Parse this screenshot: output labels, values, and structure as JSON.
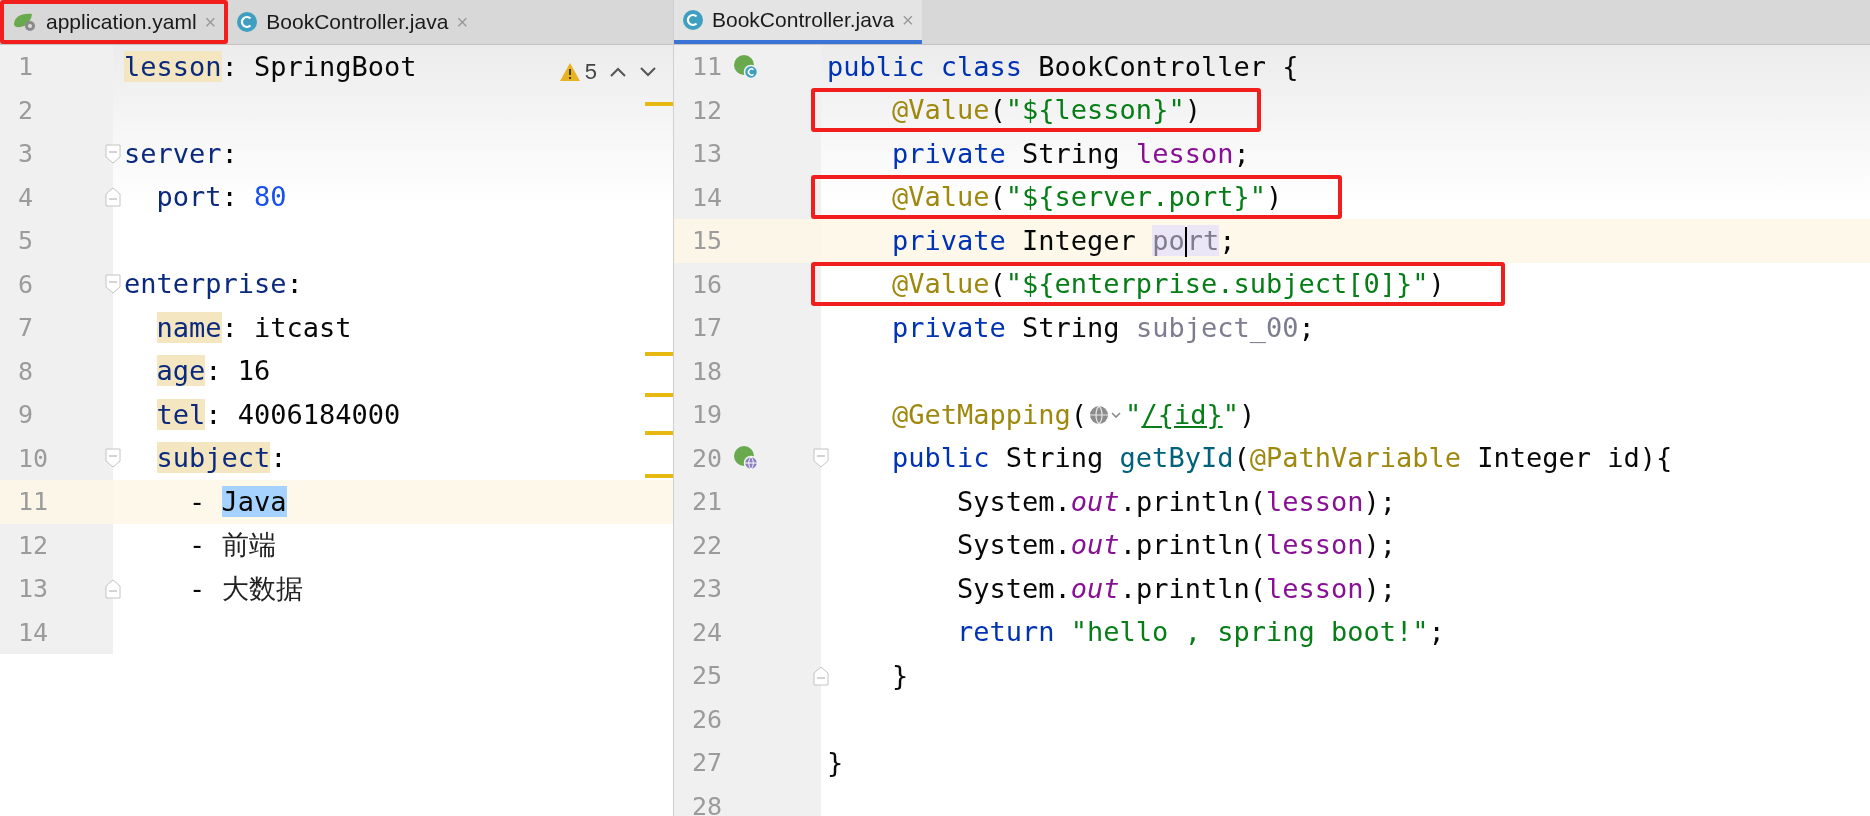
{
  "panes": [
    {
      "tabs": [
        {
          "label": "application.yaml",
          "kind": "yaml",
          "close": "×",
          "selected": false,
          "boxed": true
        },
        {
          "label": "BookController.java",
          "kind": "java",
          "close": "×",
          "selected": false,
          "boxed": false
        }
      ],
      "inspections": {
        "count": "5"
      },
      "lines": [
        {
          "n": "1",
          "current": false,
          "tokens": [
            {
              "t": "lesson",
              "kind": "usedkey"
            },
            {
              "t": ": SpringBoot",
              "kind": "plain"
            }
          ]
        },
        {
          "n": "2",
          "current": false
        },
        {
          "n": "3",
          "current": false,
          "fold": {
            "kind": "start"
          },
          "tokens": [
            {
              "t": "server",
              "kind": "key"
            },
            {
              "t": ":",
              "kind": "plain"
            }
          ]
        },
        {
          "n": "4",
          "current": false,
          "fold": {
            "kind": "end"
          },
          "tokens": [
            {
              "t": "  port",
              "kind": "key"
            },
            {
              "t": ": ",
              "kind": "plain"
            },
            {
              "t": "80",
              "kind": "number"
            }
          ]
        },
        {
          "n": "5",
          "current": false
        },
        {
          "n": "6",
          "current": false,
          "fold": {
            "kind": "start"
          },
          "tokens": [
            {
              "t": "enterprise",
              "kind": "key"
            },
            {
              "t": ":",
              "kind": "plain"
            }
          ]
        },
        {
          "n": "7",
          "current": false,
          "tokens": [
            {
              "t": "  name",
              "kind": "usedkey"
            },
            {
              "t": ": itcast",
              "kind": "plain"
            }
          ]
        },
        {
          "n": "8",
          "current": false,
          "tokens": [
            {
              "t": "  age",
              "kind": "usedkey"
            },
            {
              "t": ": 16",
              "kind": "plain"
            }
          ]
        },
        {
          "n": "9",
          "current": false,
          "tokens": [
            {
              "t": "  tel",
              "kind": "usedkey"
            },
            {
              "t": ": 4006184000",
              "kind": "plain"
            }
          ]
        },
        {
          "n": "10",
          "current": false,
          "fold": {
            "kind": "start"
          },
          "tokens": [
            {
              "t": "  subject",
              "kind": "usedkey"
            },
            {
              "t": ":",
              "kind": "plain"
            }
          ]
        },
        {
          "n": "11",
          "current": true,
          "tokens": [
            {
              "t": "    - ",
              "kind": "plain"
            },
            {
              "t": "Java",
              "kind": "selectedtext"
            }
          ]
        },
        {
          "n": "12",
          "current": false,
          "tokens": [
            {
              "t": "    - ",
              "kind": "plain"
            },
            {
              "t": "前端",
              "kind": "cjk"
            }
          ]
        },
        {
          "n": "13",
          "current": false,
          "fold": {
            "kind": "end"
          },
          "tokens": [
            {
              "t": "    - ",
              "kind": "plain"
            },
            {
              "t": "大数据",
              "kind": "cjk"
            }
          ]
        },
        {
          "n": "14",
          "current": false
        }
      ]
    },
    {
      "tabs": [
        {
          "label": "BookController.java",
          "kind": "java",
          "close": "×",
          "selected": true,
          "boxed": false
        }
      ],
      "lines": [
        {
          "n": "11",
          "current": false,
          "boxed": false,
          "marker": {
            "kind": "class"
          },
          "tokens": [
            {
              "t": "public class ",
              "kind": "keyword"
            },
            {
              "t": "BookController {",
              "kind": "plain"
            }
          ]
        },
        {
          "n": "12",
          "current": false,
          "boxed": true,
          "tokens": [
            {
              "t": "    @Value",
              "kind": "annotation"
            },
            {
              "t": "(",
              "kind": "plain"
            },
            {
              "t": "\"${lesson}\"",
              "kind": "string"
            },
            {
              "t": ")",
              "kind": "plain"
            }
          ]
        },
        {
          "n": "13",
          "current": false,
          "boxed": false,
          "tokens": [
            {
              "t": "    private ",
              "kind": "keyword"
            },
            {
              "t": "String ",
              "kind": "plain"
            },
            {
              "t": "lesson",
              "kind": "field"
            },
            {
              "t": ";",
              "kind": "plain"
            }
          ]
        },
        {
          "n": "14",
          "current": false,
          "boxed": true,
          "tokens": [
            {
              "t": "    @Value",
              "kind": "annotation"
            },
            {
              "t": "(",
              "kind": "plain"
            },
            {
              "t": "\"${server.port}\"",
              "kind": "string"
            },
            {
              "t": ")",
              "kind": "plain"
            }
          ]
        },
        {
          "n": "15",
          "current": true,
          "boxed": false,
          "tokens": [
            {
              "t": "    private ",
              "kind": "keyword"
            },
            {
              "t": "Integer ",
              "kind": "plain"
            },
            {
              "t": "po",
              "kind": "wordunused"
            },
            {
              "kind": "caret"
            },
            {
              "t": "rt",
              "kind": "wordunused"
            },
            {
              "t": ";",
              "kind": "plain"
            }
          ]
        },
        {
          "n": "16",
          "current": false,
          "boxed": true,
          "tokens": [
            {
              "t": "    @Value",
              "kind": "annotation"
            },
            {
              "t": "(",
              "kind": "plain"
            },
            {
              "t": "\"${enterprise.subject[0]}\"",
              "kind": "string"
            },
            {
              "t": ")",
              "kind": "plain"
            }
          ]
        },
        {
          "n": "17",
          "current": false,
          "boxed": false,
          "tokens": [
            {
              "t": "    private ",
              "kind": "keyword"
            },
            {
              "t": "String ",
              "kind": "plain"
            },
            {
              "t": "subject_00",
              "kind": "unused"
            },
            {
              "t": ";",
              "kind": "plain"
            }
          ]
        },
        {
          "n": "18",
          "current": false,
          "boxed": false
        },
        {
          "n": "19",
          "current": false,
          "boxed": false,
          "tokens": [
            {
              "t": "    @GetMapping",
              "kind": "annotation"
            },
            {
              "t": "(",
              "kind": "plain"
            },
            {
              "kind": "urlicon"
            },
            {
              "t": "\"",
              "kind": "string"
            },
            {
              "t": "/{id}",
              "kind": "url"
            },
            {
              "t": "\"",
              "kind": "string"
            },
            {
              "t": ")",
              "kind": "plain"
            }
          ]
        },
        {
          "n": "20",
          "current": false,
          "boxed": false,
          "marker": {
            "kind": "web"
          },
          "fold": {
            "kind": "start"
          },
          "tokens": [
            {
              "t": "    public ",
              "kind": "keyword"
            },
            {
              "t": "String ",
              "kind": "plain"
            },
            {
              "t": "getById",
              "kind": "method"
            },
            {
              "t": "(",
              "kind": "plain"
            },
            {
              "t": "@PathVariable",
              "kind": "annotation"
            },
            {
              "t": " Integer id){",
              "kind": "plain"
            }
          ]
        },
        {
          "n": "21",
          "current": false,
          "boxed": false,
          "tokens": [
            {
              "t": "        System.",
              "kind": "plain"
            },
            {
              "t": "out",
              "kind": "static"
            },
            {
              "t": ".println(",
              "kind": "plain"
            },
            {
              "t": "lesson",
              "kind": "field"
            },
            {
              "t": ");",
              "kind": "plain"
            }
          ]
        },
        {
          "n": "22",
          "current": false,
          "boxed": false,
          "tokens": [
            {
              "t": "        System.",
              "kind": "plain"
            },
            {
              "t": "out",
              "kind": "static"
            },
            {
              "t": ".println(",
              "kind": "plain"
            },
            {
              "t": "lesson",
              "kind": "field"
            },
            {
              "t": ");",
              "kind": "plain"
            }
          ]
        },
        {
          "n": "23",
          "current": false,
          "boxed": false,
          "tokens": [
            {
              "t": "        System.",
              "kind": "plain"
            },
            {
              "t": "out",
              "kind": "static"
            },
            {
              "t": ".println(",
              "kind": "plain"
            },
            {
              "t": "lesson",
              "kind": "field"
            },
            {
              "t": ");",
              "kind": "plain"
            }
          ]
        },
        {
          "n": "24",
          "current": false,
          "boxed": false,
          "tokens": [
            {
              "t": "        return ",
              "kind": "keyword"
            },
            {
              "t": "\"hello , spring boot!\"",
              "kind": "string"
            },
            {
              "t": ";",
              "kind": "plain"
            }
          ]
        },
        {
          "n": "25",
          "current": false,
          "boxed": false,
          "fold": {
            "kind": "end"
          },
          "tokens": [
            {
              "t": "    }",
              "kind": "plain"
            }
          ]
        },
        {
          "n": "26",
          "current": false,
          "boxed": false
        },
        {
          "n": "27",
          "current": false,
          "boxed": false,
          "tokens": [
            {
              "t": "}",
              "kind": "plain"
            }
          ]
        },
        {
          "n": "28",
          "current": false,
          "boxed": false
        }
      ]
    }
  ]
}
